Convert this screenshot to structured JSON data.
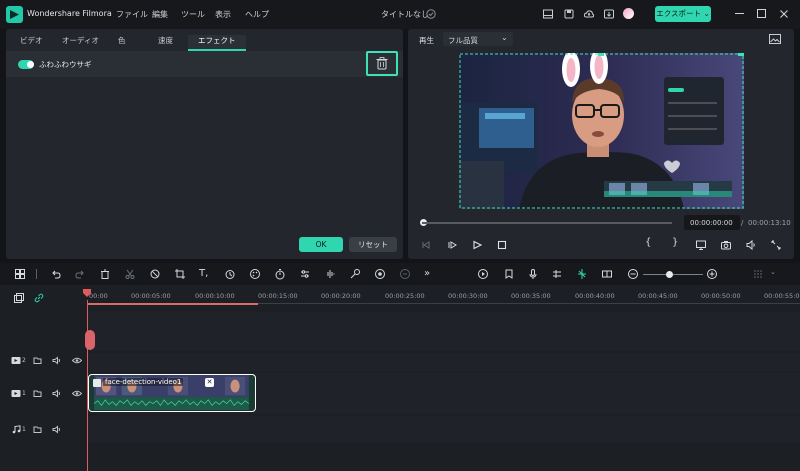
{
  "app": {
    "name": "Wondershare Filmora",
    "menus": [
      "ファイル",
      "編集",
      "ツール",
      "表示",
      "ヘルプ"
    ],
    "project_title": "タイトルなし",
    "export_label": "エクスポート"
  },
  "left_panel": {
    "tabs": [
      "ビデオ",
      "オーディオ",
      "色",
      "速度",
      "エフェクト"
    ],
    "active_tab": "エフェクト",
    "effect_name": "ふわふわウサギ",
    "ok_label": "OK",
    "reset_label": "リセット"
  },
  "preview": {
    "play_label": "再生",
    "quality": "フル品質",
    "current_time": "00:00:00:00",
    "separator": "/",
    "total_time": "00:00:13:10"
  },
  "timeline": {
    "ruler_labels": [
      "00:00",
      "00:00:05:00",
      "00:00:10:00",
      "00:00:15:00",
      "00:00:20:00",
      "00:00:25:00",
      "00:00:30:00",
      "00:00:35:00",
      "00:00:40:00",
      "00:00:45:00",
      "00:00:50:00",
      "00:00:55:00"
    ],
    "tracks": [
      {
        "icon": "video-track-icon",
        "index": "2"
      },
      {
        "icon": "video-track-icon",
        "index": "1"
      },
      {
        "icon": "music-track-icon",
        "index": "1"
      }
    ],
    "clip_label": "face-detection-video1"
  },
  "colors": {
    "accent": "#2fd6b0",
    "highlight_border": "#3ee2b8",
    "playhead": "#e05b5b"
  }
}
